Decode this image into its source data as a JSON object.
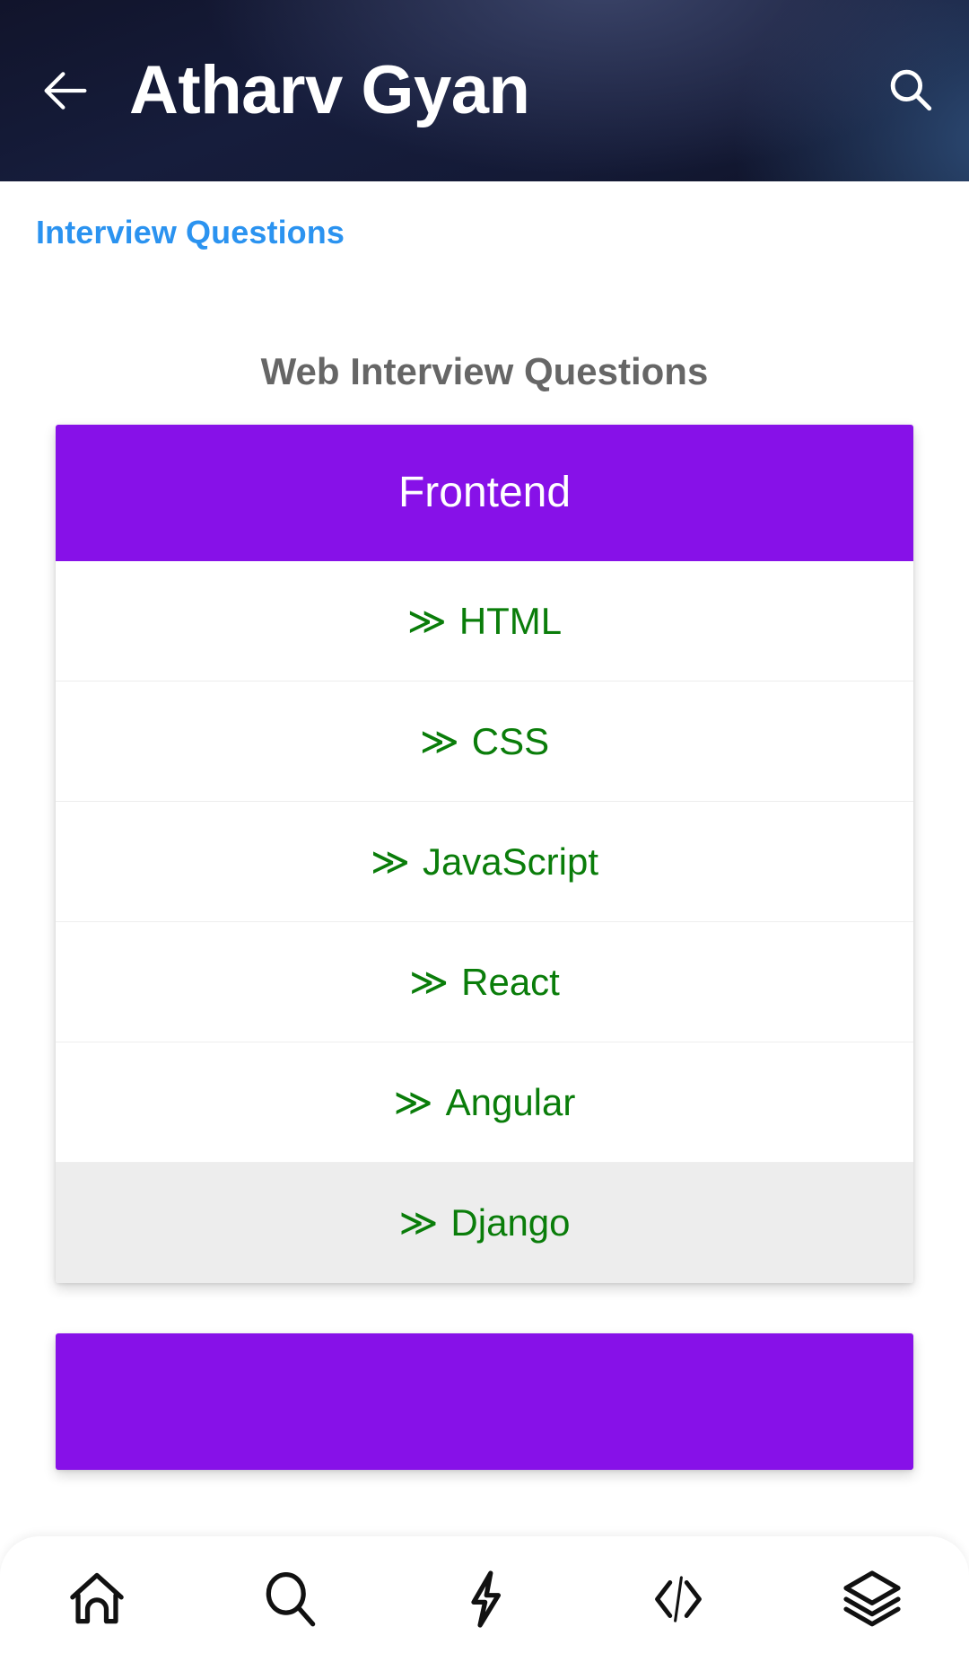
{
  "appbar": {
    "title": "Atharv Gyan",
    "back_icon": "arrow-left-icon",
    "search_icon": "search-icon"
  },
  "breadcrumb": {
    "label": "Interview Questions",
    "color": "#2b93f0"
  },
  "main": {
    "section_title": "Web Interview Questions",
    "card": {
      "header": "Frontend",
      "header_color": "#8711e8",
      "item_color": "#0a7d0a",
      "chevron": "≫",
      "items": [
        {
          "label": "HTML",
          "active": false
        },
        {
          "label": "CSS",
          "active": false
        },
        {
          "label": "JavaScript",
          "active": false
        },
        {
          "label": "React",
          "active": false
        },
        {
          "label": "Angular",
          "active": false
        },
        {
          "label": "Django",
          "active": true
        }
      ]
    },
    "card2": {
      "header": ""
    }
  },
  "bottom_nav": {
    "items": [
      {
        "icon": "home-icon",
        "label": ""
      },
      {
        "icon": "search-icon",
        "label": ""
      },
      {
        "icon": "lightning-icon",
        "label": ""
      },
      {
        "icon": "code-icon",
        "label": ""
      },
      {
        "icon": "layers-icon",
        "label": ""
      }
    ]
  }
}
